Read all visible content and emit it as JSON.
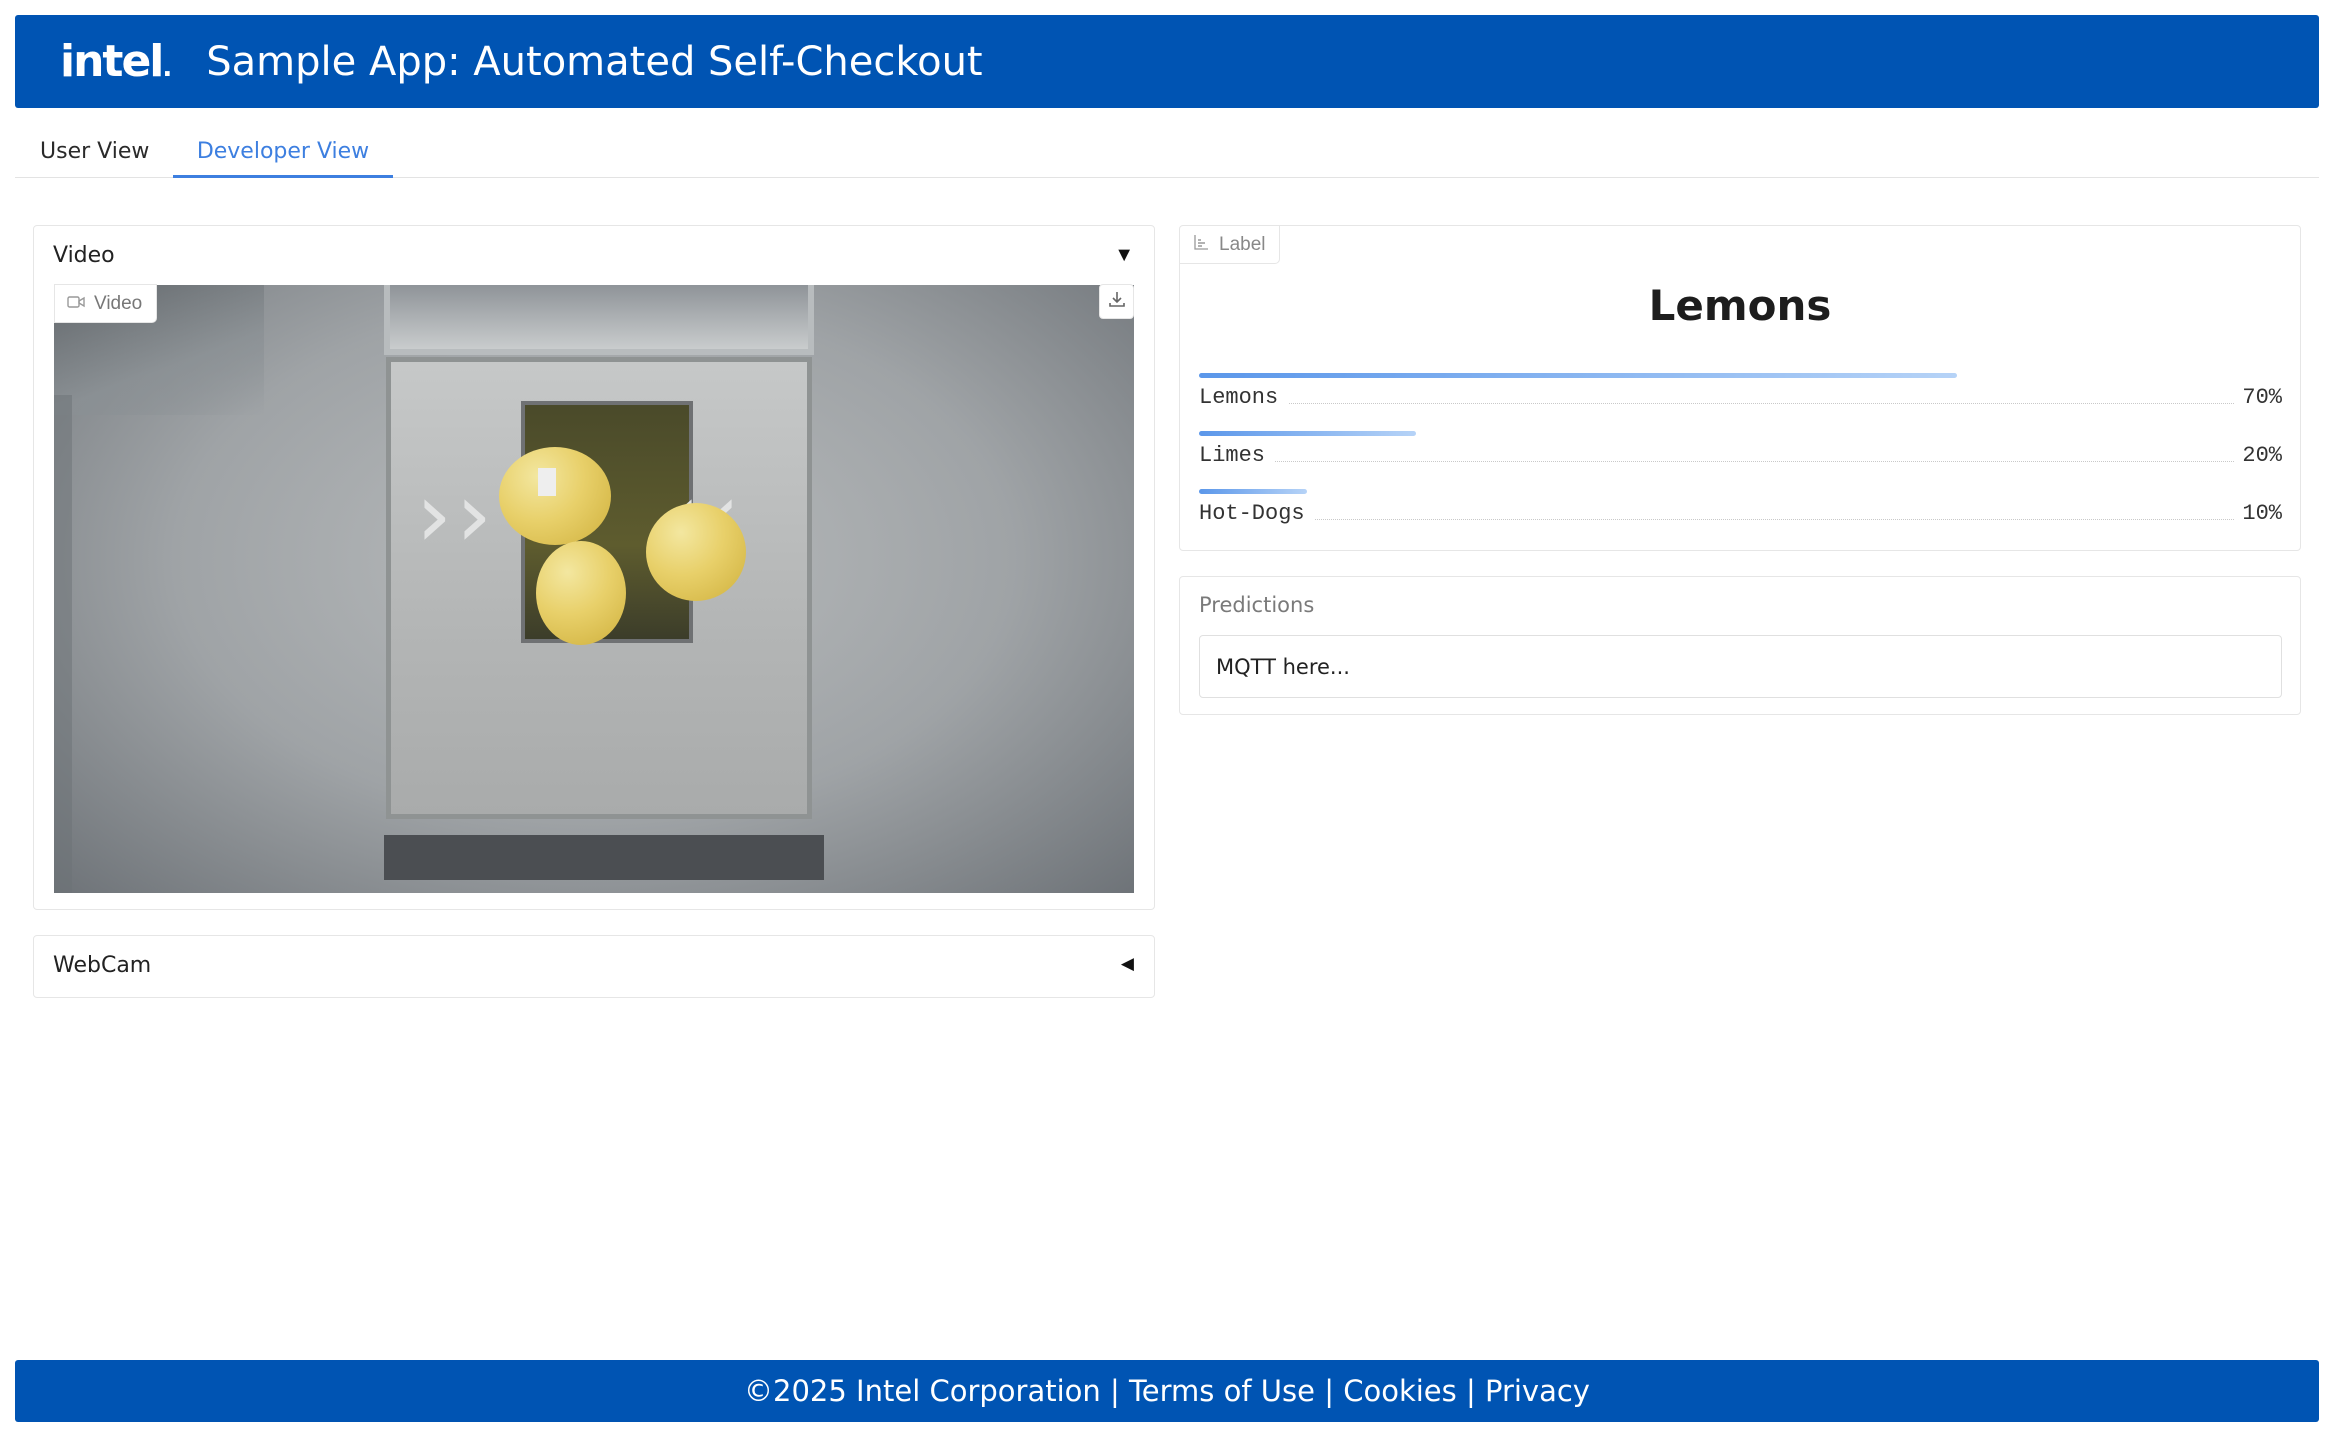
{
  "header": {
    "logo_text": "intel",
    "logo_dot": ".",
    "title": "Sample App: Automated Self-Checkout",
    "brand_color": "#0054b3"
  },
  "tabs": [
    {
      "label": "User View",
      "active": false
    },
    {
      "label": "Developer View",
      "active": true
    }
  ],
  "video_section": {
    "title": "Video",
    "toggle_icon": "▼",
    "badge_label": "Video",
    "badge_icon": "video-camera-icon",
    "download_icon": "download-icon"
  },
  "webcam_section": {
    "title": "WebCam",
    "toggle_icon": "◀"
  },
  "label_section": {
    "badge_label": "Label",
    "badge_icon": "bar-chart-icon",
    "top_label": "Lemons",
    "confidences": [
      {
        "label": "Lemons",
        "value": "70%",
        "fraction": 0.7
      },
      {
        "label": "Limes",
        "value": "20%",
        "fraction": 0.2
      },
      {
        "label": "Hot-Dogs",
        "value": "10%",
        "fraction": 0.1
      }
    ]
  },
  "predictions_section": {
    "title": "Predictions",
    "value": "MQTT here..."
  },
  "footer": {
    "copyright": "©2025 Intel Corporation",
    "separator": " | ",
    "links": [
      "Terms of Use",
      "Cookies",
      "Privacy"
    ]
  }
}
